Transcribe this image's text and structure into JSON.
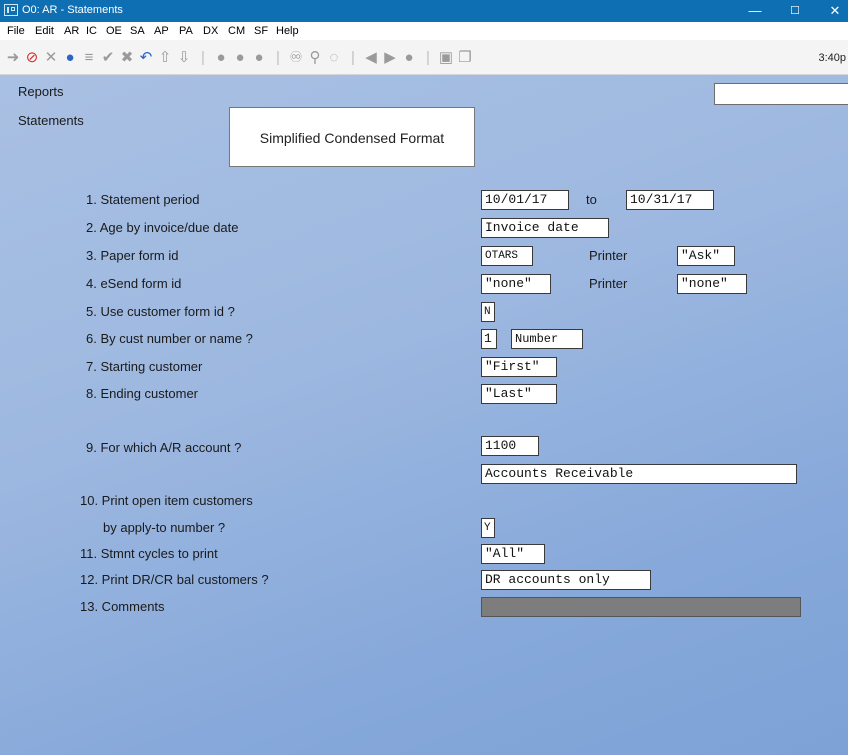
{
  "window": {
    "title": "O0: AR - Statements",
    "minimize": "—",
    "maximize": "☐",
    "close": "✕"
  },
  "menu": [
    "File",
    "Edit",
    "AR",
    "IC",
    "OE",
    "SA",
    "AP",
    "PA",
    "DX",
    "CM",
    "SF",
    "Help"
  ],
  "toolbar": {
    "icons": [
      "arrow-right-icon",
      "stop-icon",
      "tools-icon",
      "record-icon",
      "list-icon",
      "check-icon",
      "x-icon",
      "undo-icon",
      "up-icon",
      "down-icon",
      "circle-1-icon",
      "circle-2-icon",
      "circle-3-icon",
      "binoculars-icon",
      "search-icon",
      "refresh-icon",
      "prev-icon",
      "next-icon",
      "record-2-icon",
      "save-icon",
      "copy-icon"
    ],
    "clock": "3:40p"
  },
  "nav": {
    "reports": "Reports",
    "statements": "Statements"
  },
  "format_title": "Simplified Condensed Format",
  "fields": {
    "f1_label": "1. Statement period",
    "f1_from": "10/01/17",
    "f1_to_label": "to",
    "f1_to": "10/31/17",
    "f2_label": "2. Age by invoice/due date",
    "f2_value": "Invoice date",
    "f3_label": "3. Paper form id",
    "f3_value": "OTARS",
    "f3_printer_label": "Printer",
    "f3_printer": "\"Ask\"",
    "f4_label": "4. eSend form id",
    "f4_value": "\"none\"",
    "f4_printer_label": "Printer",
    "f4_printer": "\"none\"",
    "f5_label": "5. Use customer form id ?",
    "f5_value": "N",
    "f6_label": "6. By cust number or name ?",
    "f6_value": "1",
    "f6_desc": "Number",
    "f7_label": "7. Starting customer",
    "f7_value": "\"First\"",
    "f8_label": "8. Ending customer",
    "f8_value": "\"Last\"",
    "f9_label": "9. For which A/R account ?",
    "f9_value": "1100",
    "f9_desc": "Accounts Receivable",
    "f10_label": "10. Print open item customers",
    "f10_label2": "by apply-to number ?",
    "f10_value": "Y",
    "f11_label": "11. Stmnt cycles to print",
    "f11_value": "\"All\"",
    "f12_label": "12. Print DR/CR bal customers ?",
    "f12_value": "DR accounts only",
    "f13_label": "13. Comments",
    "f13_value": ""
  }
}
